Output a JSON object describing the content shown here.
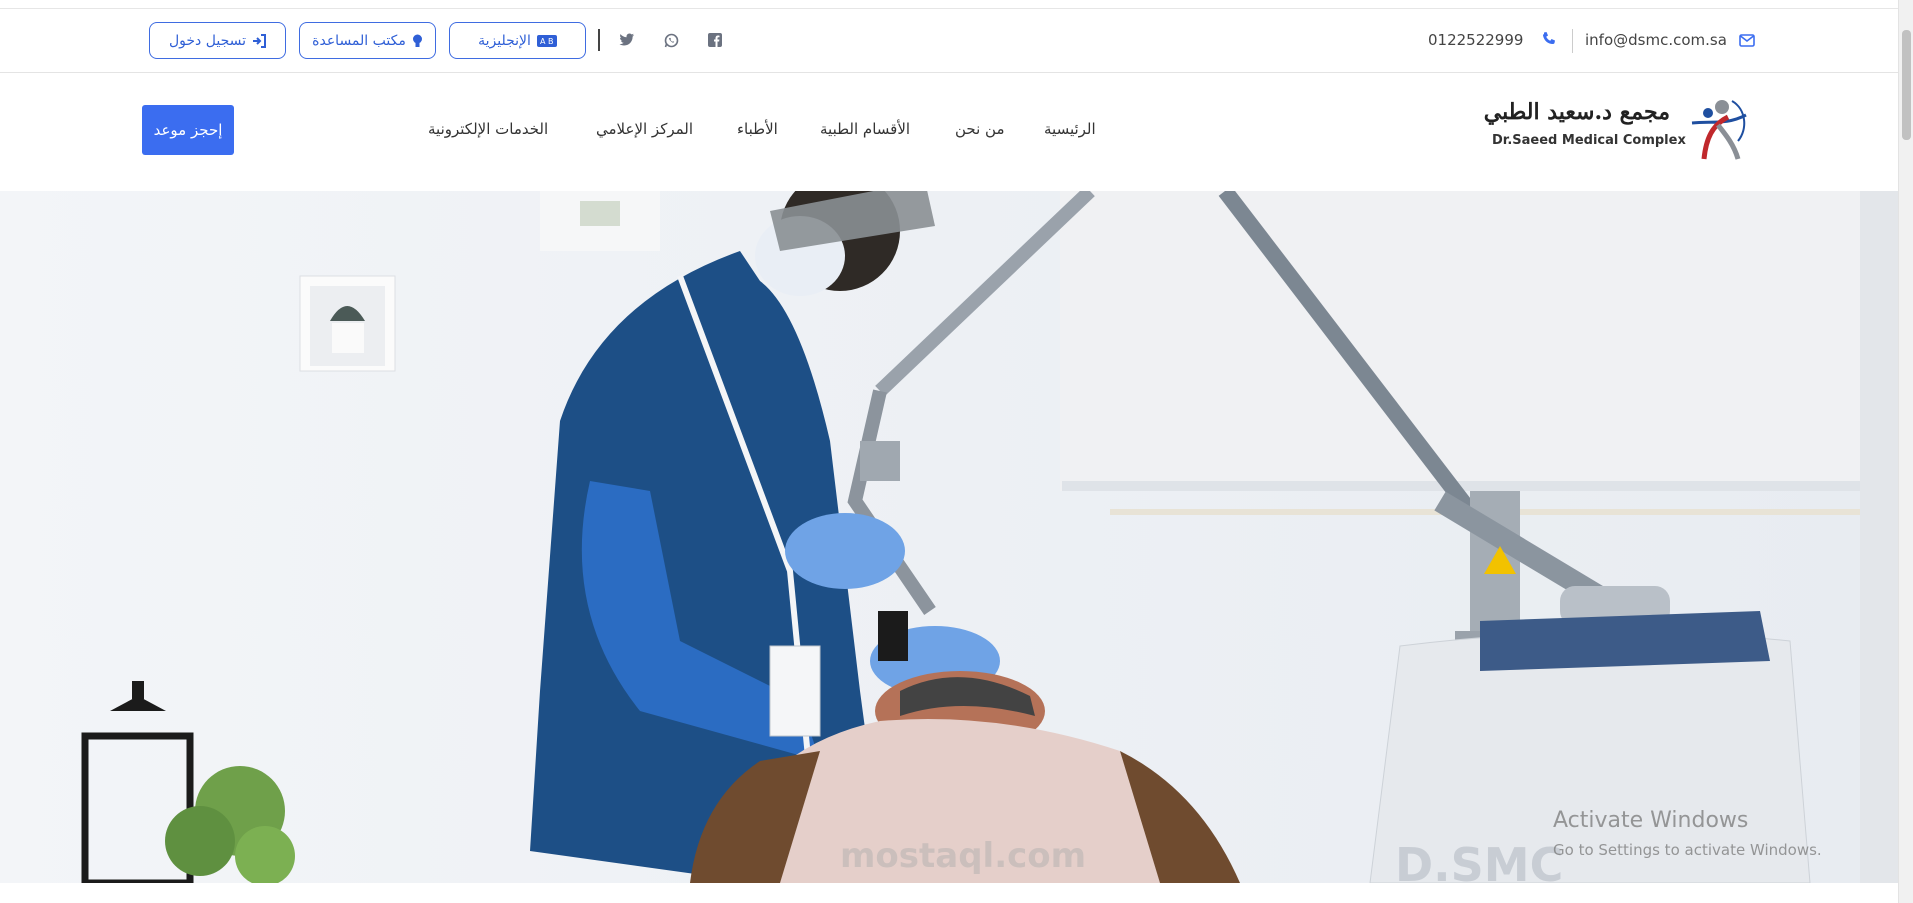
{
  "topbar": {
    "login_label": "تسجيل دخول",
    "help_label": "مكتب المساعدة",
    "lang_label": "الإنجليزية",
    "phone": "0122522999",
    "email": "info@dsmc.com.sa",
    "social": [
      "twitter-icon",
      "whatsapp-icon",
      "facebook-icon"
    ]
  },
  "navbar": {
    "book_label": "إحجز موعد",
    "items": [
      {
        "label": "الخدمات الإلكترونية"
      },
      {
        "label": "المركز الإعلامي"
      },
      {
        "label": "الأطباء"
      },
      {
        "label": "الأقسام الطبية"
      },
      {
        "label": "من نحن"
      },
      {
        "label": "الرئيسية"
      }
    ]
  },
  "logo": {
    "arabic": "مجمع د.سعيد الطبي",
    "english": "Dr.Saeed Medical Complex"
  },
  "hero": {
    "watermark": "mostaql.com",
    "machine_label": "D.SMC"
  },
  "os_overlay": {
    "title": "Activate Windows",
    "subtitle": "Go to Settings to activate Windows."
  },
  "colors": {
    "accent": "#3b6df0",
    "outline": "#3f6ce1"
  }
}
